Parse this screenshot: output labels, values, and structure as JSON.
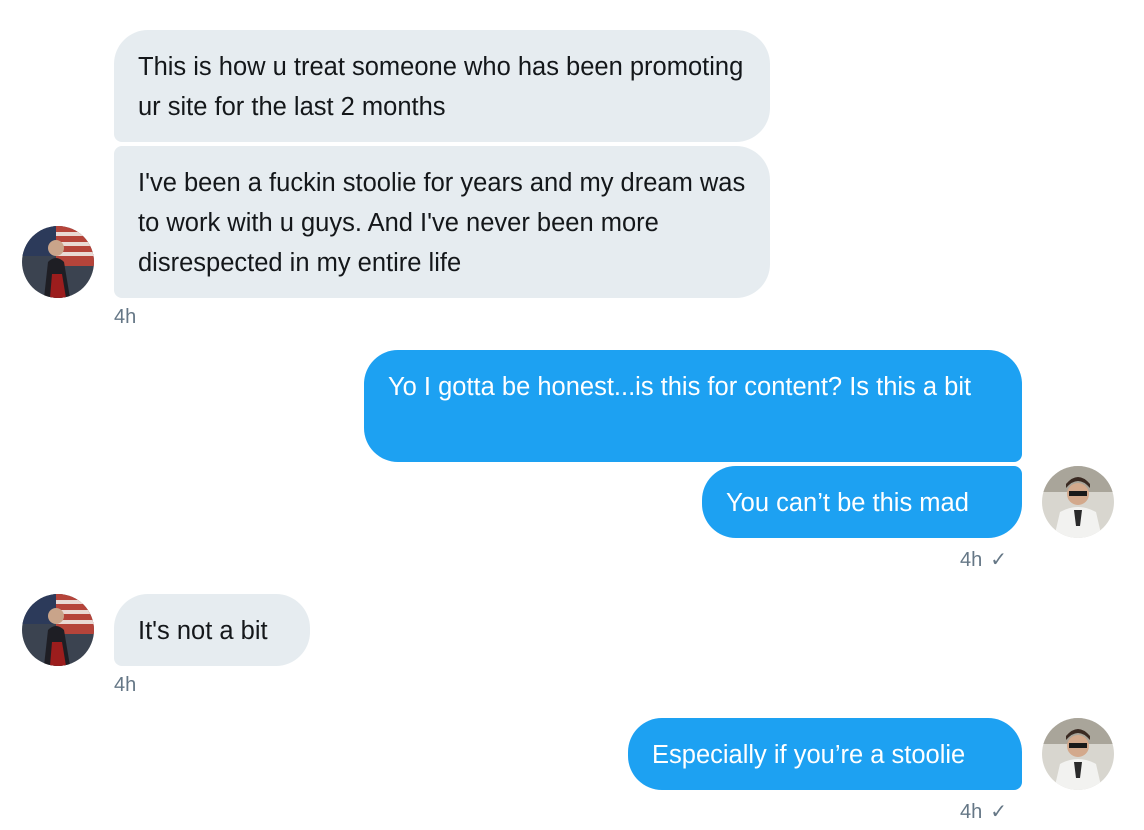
{
  "messages": [
    {
      "side": "in",
      "text": "This is how u treat someone who has been promoting ur site for the last 2 months"
    },
    {
      "side": "in",
      "text": "I've been a fuckin stoolie for years and my dream was to work with u guys. And I've never been more disrespected in my entire life"
    },
    {
      "side": "out",
      "text": "Yo I gotta be honest...is this for content? Is this a bit"
    },
    {
      "side": "out",
      "text": "You can’t be this mad"
    },
    {
      "side": "in",
      "text": "It's not a bit"
    },
    {
      "side": "out",
      "text": "Especially if you’re a stoolie"
    }
  ],
  "timestamps": {
    "group1": "4h",
    "group2": "4h",
    "group3": "4h",
    "group4": "4h"
  },
  "read_receipt": "✓",
  "colors": {
    "incoming_bubble": "#e6ecf0",
    "outgoing_bubble": "#1da1f2",
    "meta_text": "#657786"
  },
  "icons": {
    "incoming_avatar": "user-avatar",
    "outgoing_avatar": "user-avatar",
    "read_receipt": "checkmark-icon"
  }
}
